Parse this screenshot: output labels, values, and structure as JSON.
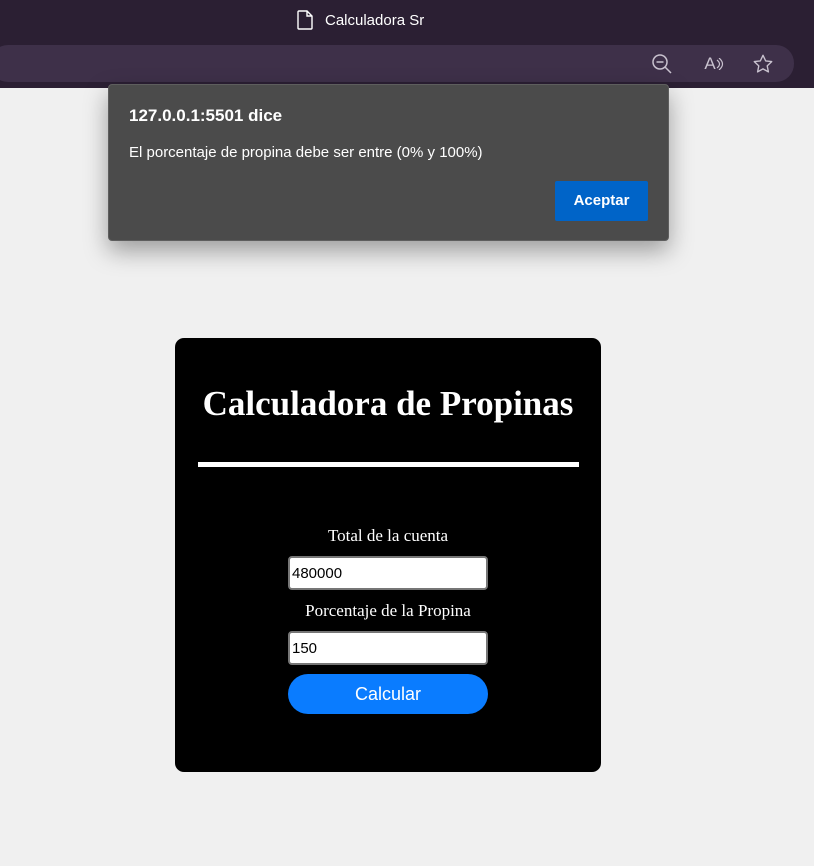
{
  "browser": {
    "tab_title": "Calculadora Sr",
    "toolbar_icons": [
      "zoom-out-icon",
      "read-aloud-icon",
      "favorite-star-icon"
    ],
    "read_aloud_glyph": "A"
  },
  "alert": {
    "origin": "127.0.0.1:5501 dice",
    "message": "El porcentaje de propina debe ser entre (0% y 100%)",
    "accept_label": "Aceptar",
    "accent_color": "#0064c8"
  },
  "calculator": {
    "title": "Calculadora de Propinas",
    "total_label": "Total de la cuenta",
    "total_value": "480000",
    "tip_label": "Porcentaje de la Propina",
    "tip_value": "150",
    "calculate_label": "Calcular",
    "button_color": "#0a7cff"
  }
}
